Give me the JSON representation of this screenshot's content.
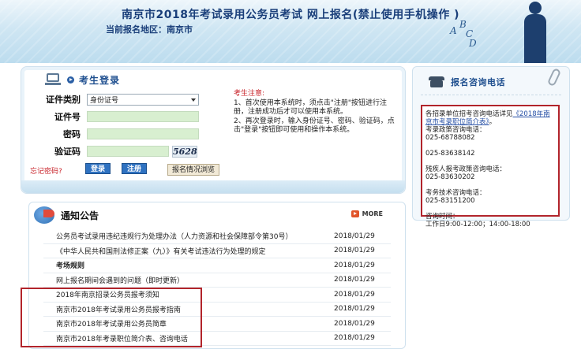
{
  "header": {
    "title": "南京市2018年考试录用公务员考试 网上报名(禁止使用手机操作 )",
    "region_label": "当前报名地区：南京市",
    "letters": [
      "A",
      "B",
      "C",
      "D"
    ]
  },
  "login": {
    "title": "考生登录",
    "fields": {
      "cert_type_label": "证件类别",
      "cert_type_value": "身份证号",
      "cert_no_label": "证件号",
      "password_label": "密码",
      "captcha_label": "验证码",
      "captcha_image": "5628"
    },
    "forgot_label": "忘记密码?",
    "login_button": "登录",
    "register_button": "注册",
    "browse_button": "报名情况浏览",
    "notice_title": "考生注意:",
    "notice_1": "1、首次使用本系统时，须点击\"注册\"按钮进行注册，注册成功后才可以使用本系统。",
    "notice_2": "2、再次登录时，输入身份证号、密码、验证码，点击\"登录\"按钮即可使用和操作本系统。"
  },
  "phone": {
    "title": "报名咨询电话",
    "intro": "各招录单位招考咨询电话详见",
    "intro_link": "《2018年南京市考录职位简介表》",
    "intro_end": "。",
    "policy_label": "考录政策咨询电话：",
    "policy_1": "025-68788082",
    "policy_2": "025-83638142",
    "disabled_label": "残疾人报考政策咨询电话：",
    "disabled_1": "025-83630202",
    "tech_label": "考务技术咨询电话：",
    "tech_1": "025-83151200",
    "hours_label": "咨询时间：",
    "hours_value": "工作日9:00-12:00；14:00-18:00"
  },
  "news": {
    "title": "通知公告",
    "more_label": "MORE",
    "items": [
      {
        "title": "公务员考试录用违纪违规行为处理办法（人力资源和社会保障部令第30号）",
        "date": "2018/01/29"
      },
      {
        "title": "《中华人民共和国刑法修正案（九）》有关考试违法行为处理的规定",
        "date": "2018/01/29"
      },
      {
        "title": "考场规则",
        "date": "2018/01/29"
      },
      {
        "title": "网上报名期间会遇到的问题（即时更新）",
        "date": "2018/01/29"
      },
      {
        "title": "2018年南京招录公务员报考须知",
        "date": "2018/01/29"
      },
      {
        "title": "南京市2018年考试录用公务员报考指南",
        "date": "2018/01/29"
      },
      {
        "title": "南京市2018年考试录用公务员简章",
        "date": "2018/01/29"
      },
      {
        "title": "南京市2018年考录职位简介表、咨询电话",
        "date": "2018/01/29"
      }
    ]
  }
}
